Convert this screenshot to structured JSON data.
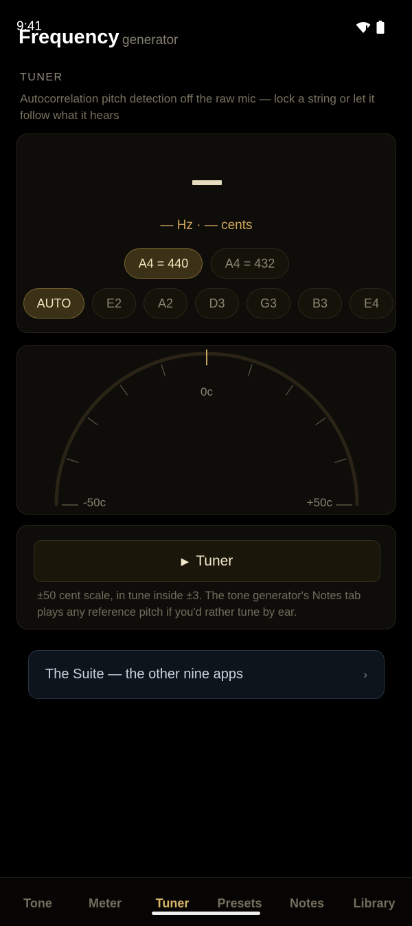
{
  "status_bar": {
    "time": "9:41",
    "wifi_icon": "wifi-icon",
    "battery_icon": "battery-icon"
  },
  "header": {
    "title": "Frequency",
    "subtitle": "generator"
  },
  "section": {
    "label": "TUNER",
    "description": "Autocorrelation pitch detection off the raw mic — lock a string or let it follow what it hears"
  },
  "readout": {
    "note": "—",
    "hz_cents": "— Hz · — cents"
  },
  "reference": {
    "options": [
      "A4 = 440",
      "A4 = 432"
    ],
    "selected": "A4 = 440"
  },
  "strings": {
    "options": [
      "AUTO",
      "E2",
      "A2",
      "D3",
      "G3",
      "B3",
      "E4"
    ],
    "selected": "AUTO"
  },
  "gauge": {
    "center_label": "0c",
    "min_label": "-50c",
    "max_label": "+50c",
    "range_cents": [
      -50,
      50
    ],
    "needle_cents": 0,
    "tick_cents": [
      -40,
      -30,
      -20,
      -10,
      0,
      10,
      20,
      30,
      40
    ]
  },
  "controls": {
    "tuner_button": {
      "icon": "play-icon",
      "label": "Tuner"
    },
    "note": "±50 cent scale, in tune inside ±3. The tone generator's Notes tab plays any reference pitch if you'd rather tune by ear."
  },
  "suite_link": {
    "label": "The Suite — the other nine apps",
    "icon": "chevron-right-icon"
  },
  "tabs": {
    "items": [
      "Tone",
      "Meter",
      "Tuner",
      "Presets",
      "Notes",
      "Library"
    ],
    "active": "Tuner"
  },
  "colors": {
    "accent": "#d7b46a",
    "background": "#000000",
    "card": "#0e0d09",
    "pill_active": "#3b3117",
    "suite_card": "#0d141b"
  }
}
